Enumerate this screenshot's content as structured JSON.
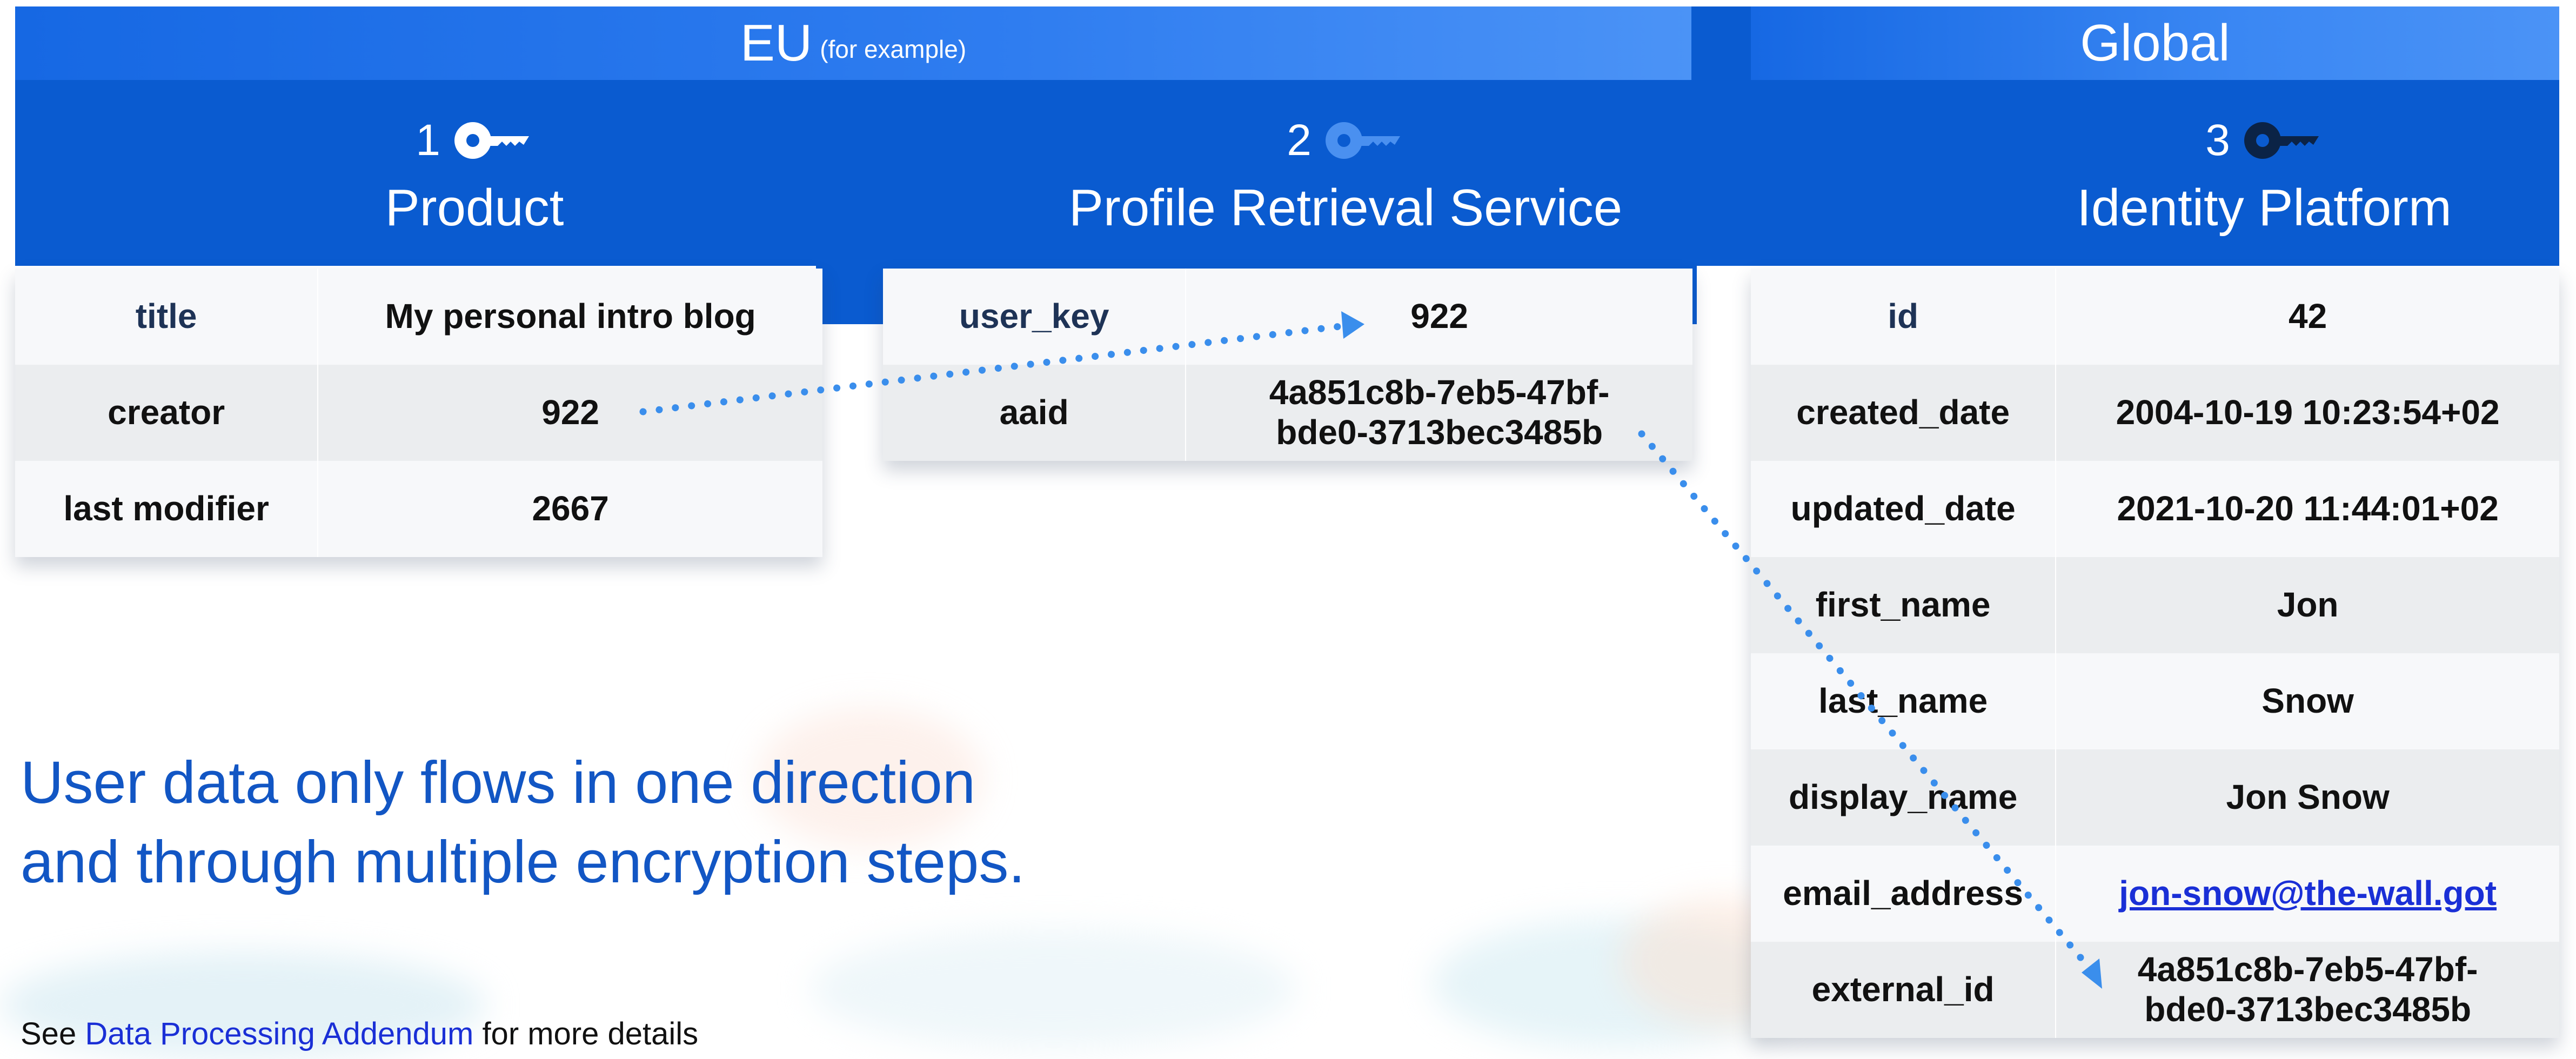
{
  "regions": {
    "eu": {
      "label": "EU",
      "sub": "(for example)"
    },
    "global": {
      "label": "Global"
    }
  },
  "services": [
    {
      "number": "1",
      "name": "Product",
      "key_color": "#ffffff"
    },
    {
      "number": "2",
      "name": "Profile Retrieval Service",
      "key_color": "#4a90f0"
    },
    {
      "number": "3",
      "name": "Identity Platform",
      "key_color": "#0b2346"
    }
  ],
  "product_table": [
    {
      "key": "title",
      "value": "My personal intro blog"
    },
    {
      "key": "creator",
      "value": "922"
    },
    {
      "key": "last modifier",
      "value": "2667"
    }
  ],
  "profile_table": [
    {
      "key": "user_key",
      "value": "922"
    },
    {
      "key": "aaid",
      "value_line1": "4a851c8b-7eb5-47bf-",
      "value_line2": "bde0-3713bec3485b"
    }
  ],
  "identity_table": [
    {
      "key": "id",
      "value": "42"
    },
    {
      "key": "created_date",
      "value": "2004-10-19 10:23:54+02"
    },
    {
      "key": "updated_date",
      "value": "2021-10-20 11:44:01+02"
    },
    {
      "key": "first_name",
      "value": "Jon"
    },
    {
      "key": "last_name",
      "value": "Snow"
    },
    {
      "key": "display_name",
      "value": "Jon Snow"
    },
    {
      "key": "email_address",
      "value": "jon-snow@the-wall.got"
    },
    {
      "key": "external_id",
      "value_line1": "4a851c8b-7eb5-47bf-",
      "value_line2": "bde0-3713bec3485b"
    }
  ],
  "tagline": {
    "line1": "User data only flows in one direction",
    "line2": "and through multiple encryption steps."
  },
  "footer": {
    "prefix": "See ",
    "link": "Data Processing Addendum",
    "suffix": " for more details"
  },
  "colors": {
    "header_blue": "#0a5bd0",
    "arrow_blue": "#3a8eec",
    "tagline_blue": "#1256c4"
  }
}
